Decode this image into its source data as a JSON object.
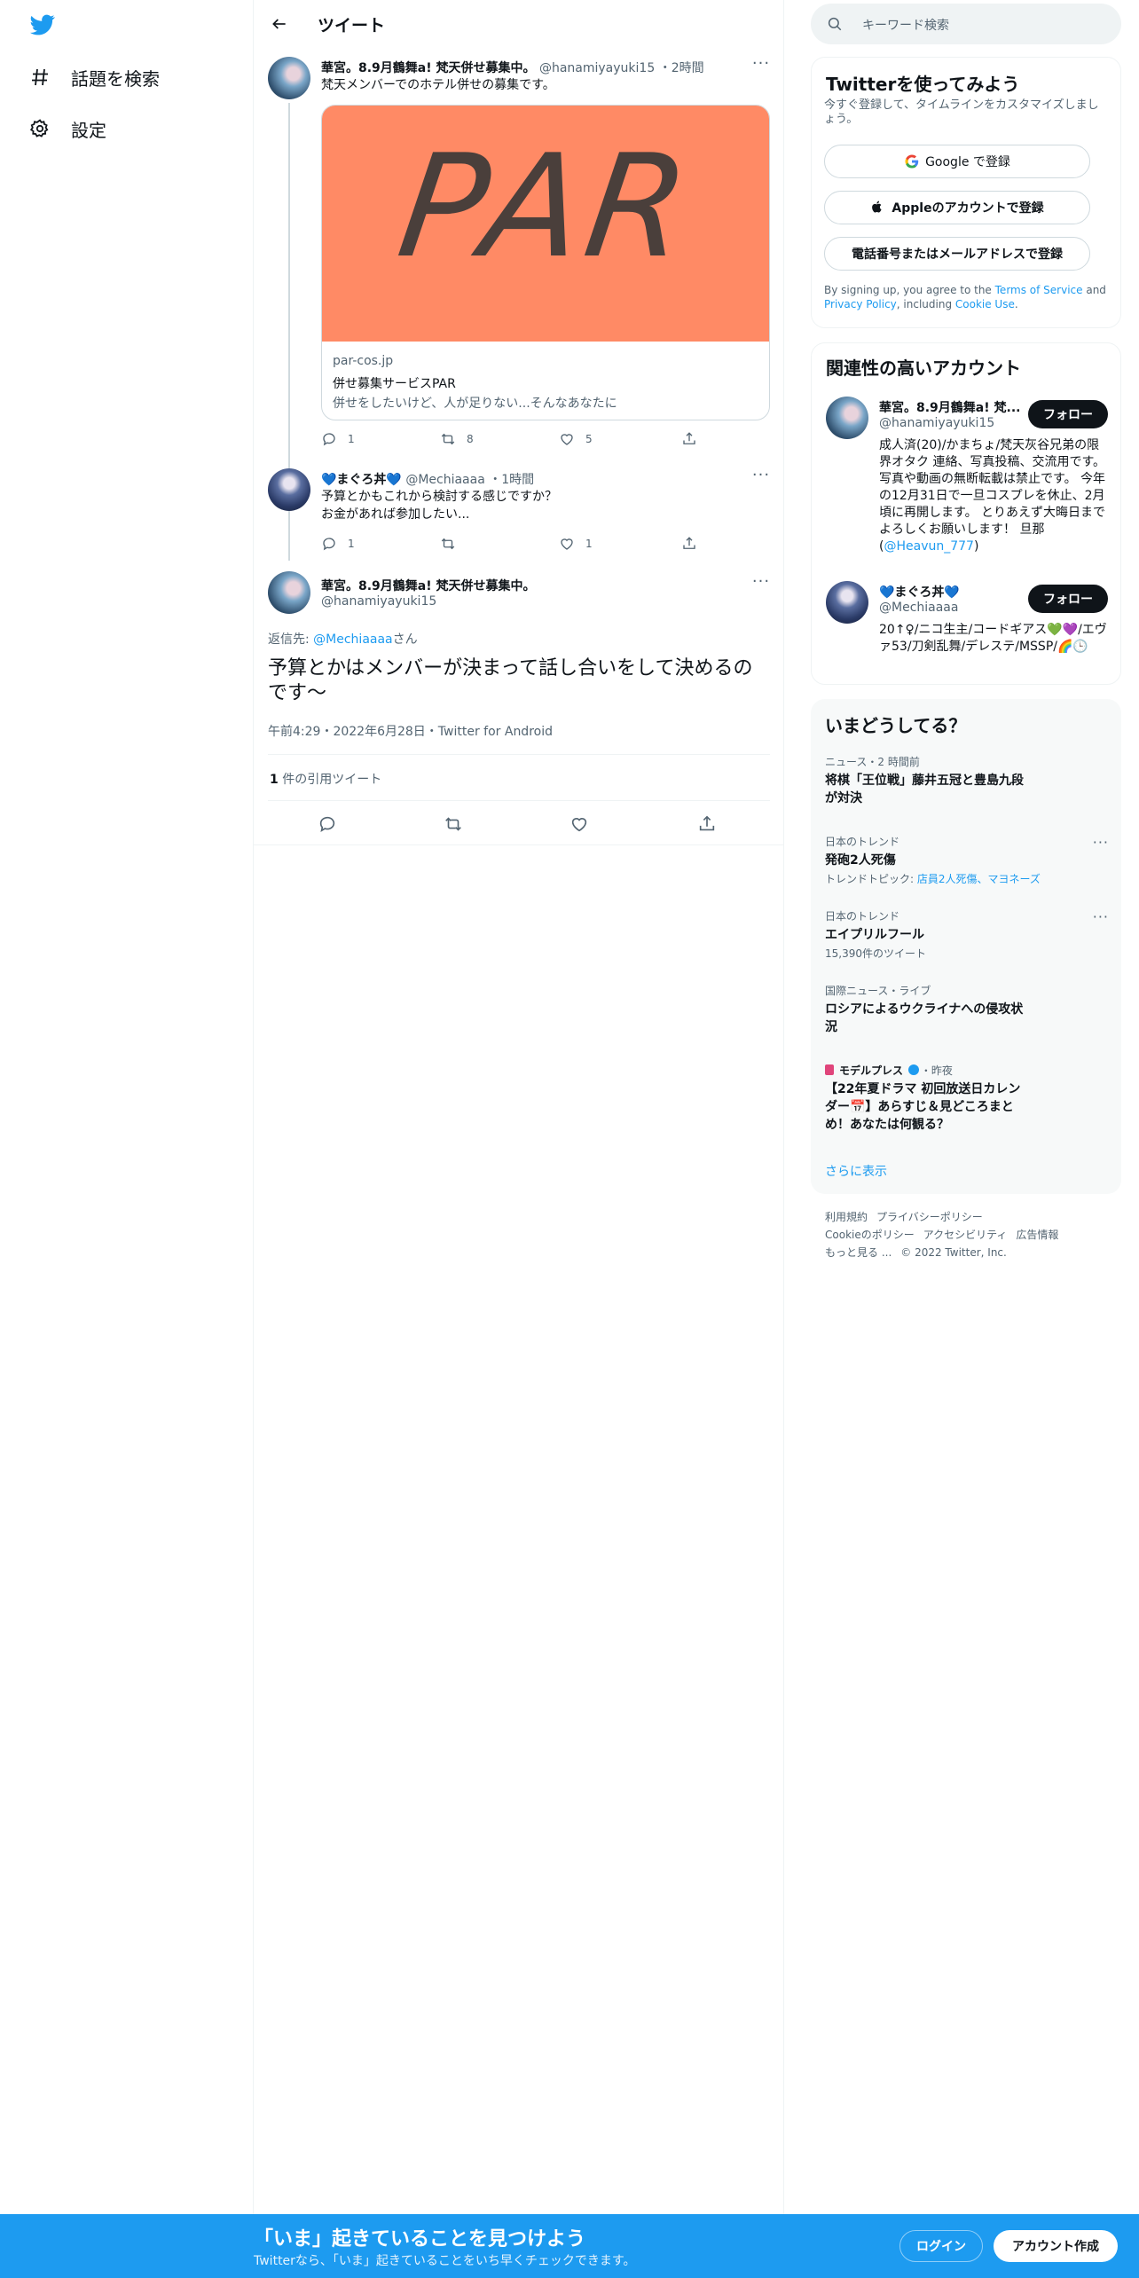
{
  "nav": {
    "items": [
      {
        "label": "話題を検索",
        "icon": "hashtag-icon"
      },
      {
        "label": "設定",
        "icon": "gear-icon"
      }
    ]
  },
  "header": {
    "title": "ツイート"
  },
  "tweet1": {
    "name": "華宮。8.9月鶴舞a! 梵天併せ募集中。",
    "handle": "@hanamiyayuki15",
    "time": "2時間",
    "text": "梵天メンバーでのホテル併せの募集です。",
    "card": {
      "image_text": "PAR",
      "domain": "par-cos.jp",
      "title": "併せ募集サービスPAR",
      "description": "併せをしたいけど、人が足りない...そんなあなたに"
    },
    "replies": "1",
    "retweets": "8",
    "likes": "5"
  },
  "tweet2": {
    "name": "💙まぐろ丼💙",
    "handle": "@Mechiaaaa",
    "time": "1時間",
    "text_line1": "予算とかもこれから検討する感じですか？",
    "text_line2": "お金があれば参加したい...",
    "replies": "1",
    "retweets": "",
    "likes": "1"
  },
  "main_tweet": {
    "name": "華宮。8.9月鶴舞a! 梵天併せ募集中。",
    "handle": "@hanamiyayuki15",
    "reply_prefix": "返信先: ",
    "reply_to": "@Mechiaaaa",
    "reply_suffix": "さん",
    "text": "予算とかはメンバーが決まって話し合いをして決めるのです〜",
    "meta": "午前4:29・2022年6月28日・Twitter for Android",
    "quote_count": "1",
    "quote_label": " 件の引用ツイート"
  },
  "search": {
    "placeholder": "キーワード検索"
  },
  "signup": {
    "title": "Twitterを使ってみよう",
    "subtitle": "今すぐ登録して、タイムラインをカスタマイズしましょう。",
    "google": "Google で登録",
    "apple": "Appleのアカウントで登録",
    "phone": "電話番号またはメールアドレスで登録",
    "terms_1": "By signing up, you agree to the ",
    "terms_tos": "Terms of Service",
    "terms_2": " and ",
    "terms_privacy": "Privacy Policy",
    "terms_3": ", including ",
    "terms_cookie": "Cookie Use",
    "terms_4": "."
  },
  "related": {
    "title": "関連性の高いアカウント",
    "follow_label": "フォロー",
    "accounts": [
      {
        "name": "華宮。8.9月鶴舞a! 梵...",
        "handle": "@hanamiyayuki15",
        "bio": "成人済(20)/かまちょ/梵天灰谷兄弟の限界オタク 連絡、写真投稿、交流用です。 写真や動画の無断転載は禁止です。 今年の12月31日で一旦コスプレを休止、2月頃に再開します。 とりあえず大晦日までよろしくお願いします！ 旦那(",
        "bio_link": "@Heavun_777",
        "bio_end": ")"
      },
      {
        "name": "💙まぐろ丼💙",
        "handle": "@Mechiaaaa",
        "bio": "20↑♀/ニコ生主/コードギアス💚💜/エヴァ53/刀剣乱舞/デレステ/MSSP/🌈🕒"
      }
    ]
  },
  "trends": {
    "title": "いまどうしてる？",
    "items": [
      {
        "context": "ニュース・2 時間前",
        "title": "将棋「王位戦」藤井五冠と豊島九段が対決",
        "sub": ""
      },
      {
        "context": "日本のトレンド",
        "title": "発砲2人死傷",
        "sub_prefix": "トレンドトピック: ",
        "sub": "店員2人死傷、マヨネーズ"
      },
      {
        "context": "日本のトレンド",
        "title": "エイプリルフール",
        "sub": "15,390件のツイート"
      },
      {
        "context": "国際ニュース・ライブ",
        "title": "ロシアによるウクライナへの侵攻状況",
        "sub": ""
      },
      {
        "context_name": "モデルプレス",
        "context_time": "・昨夜",
        "title": "【22年夏ドラマ 初回放送日カレンダー📅】あらすじ＆見どころまとめ！あなたは何観る？",
        "sub": ""
      }
    ],
    "more": "さらに表示"
  },
  "footer": {
    "links": [
      "利用規約",
      "プライバシーポリシー",
      "Cookieのポリシー",
      "アクセシビリティ",
      "広告情報",
      "もっと見る ...",
      "© 2022 Twitter, Inc."
    ]
  },
  "bottombar": {
    "title": "「いま」起きていることを見つけよう",
    "subtitle": "Twitterなら、「いま」起きていることをいち早くチェックできます。",
    "login": "ログイン",
    "signup": "アカウント作成"
  },
  "colors": {
    "brand": "#1d9bf0",
    "card_image_bg": "#ff8a65"
  }
}
